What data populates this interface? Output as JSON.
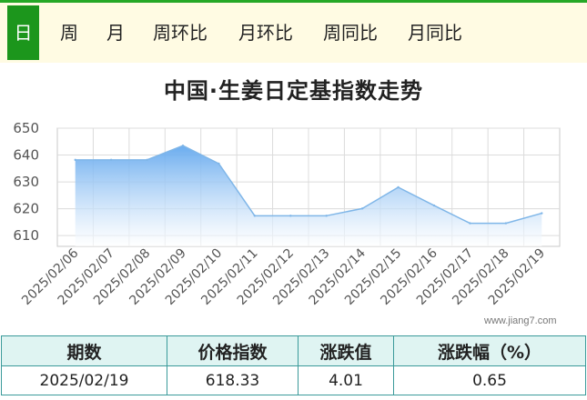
{
  "tabs": [
    {
      "label": "日",
      "active": true
    },
    {
      "label": "周"
    },
    {
      "label": "月"
    },
    {
      "label": "周环比"
    },
    {
      "label": "月环比"
    },
    {
      "label": "周同比"
    },
    {
      "label": "月同比"
    }
  ],
  "watermark": "www.jiang7.com",
  "table": {
    "headers": [
      "期数",
      "价格指数",
      "涨跌值",
      "涨跌幅（%）"
    ],
    "row": [
      "2025/02/19",
      "618.33",
      "4.01",
      "0.65"
    ]
  },
  "colors": {
    "accent": "#1c961c",
    "line": "#7fb6e8",
    "fill": "#63a8ee"
  },
  "chart_data": {
    "type": "area",
    "title": "中国·生姜日定基指数走势",
    "xlabel": "",
    "ylabel": "",
    "x": [
      "2025/02/06",
      "2025/02/07",
      "2025/02/08",
      "2025/02/09",
      "2025/02/10",
      "2025/02/11",
      "2025/02/12",
      "2025/02/13",
      "2025/02/14",
      "2025/02/15",
      "2025/02/16",
      "2025/02/17",
      "2025/02/18",
      "2025/02/19"
    ],
    "series": [
      {
        "values": [
          638.2,
          638.2,
          638.2,
          643.5,
          636.8,
          617.4,
          617.4,
          617.4,
          620.1,
          628.0,
          621.2,
          614.6,
          614.6,
          618.33
        ]
      }
    ],
    "yticks": [
      610,
      620,
      630,
      640,
      650
    ],
    "ylim": [
      606,
      650
    ],
    "grid": true
  }
}
